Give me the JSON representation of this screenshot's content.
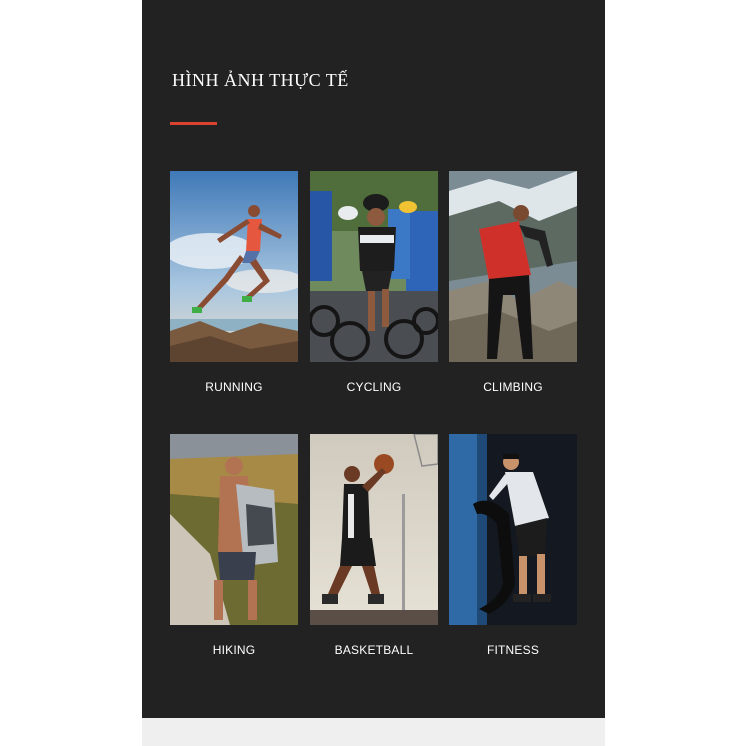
{
  "section": {
    "title": "HÌNH ẢNH THỰC TẾ",
    "accent_color": "#d9432f"
  },
  "activities": [
    {
      "label": "RUNNING",
      "image": "running-photo"
    },
    {
      "label": "CYCLING",
      "image": "cycling-photo"
    },
    {
      "label": "CLIMBING",
      "image": "climbing-photo"
    },
    {
      "label": "HIKING",
      "image": "hiking-photo"
    },
    {
      "label": "BASKETBALL",
      "image": "basketball-photo"
    },
    {
      "label": "FITNESS",
      "image": "fitness-photo"
    }
  ]
}
